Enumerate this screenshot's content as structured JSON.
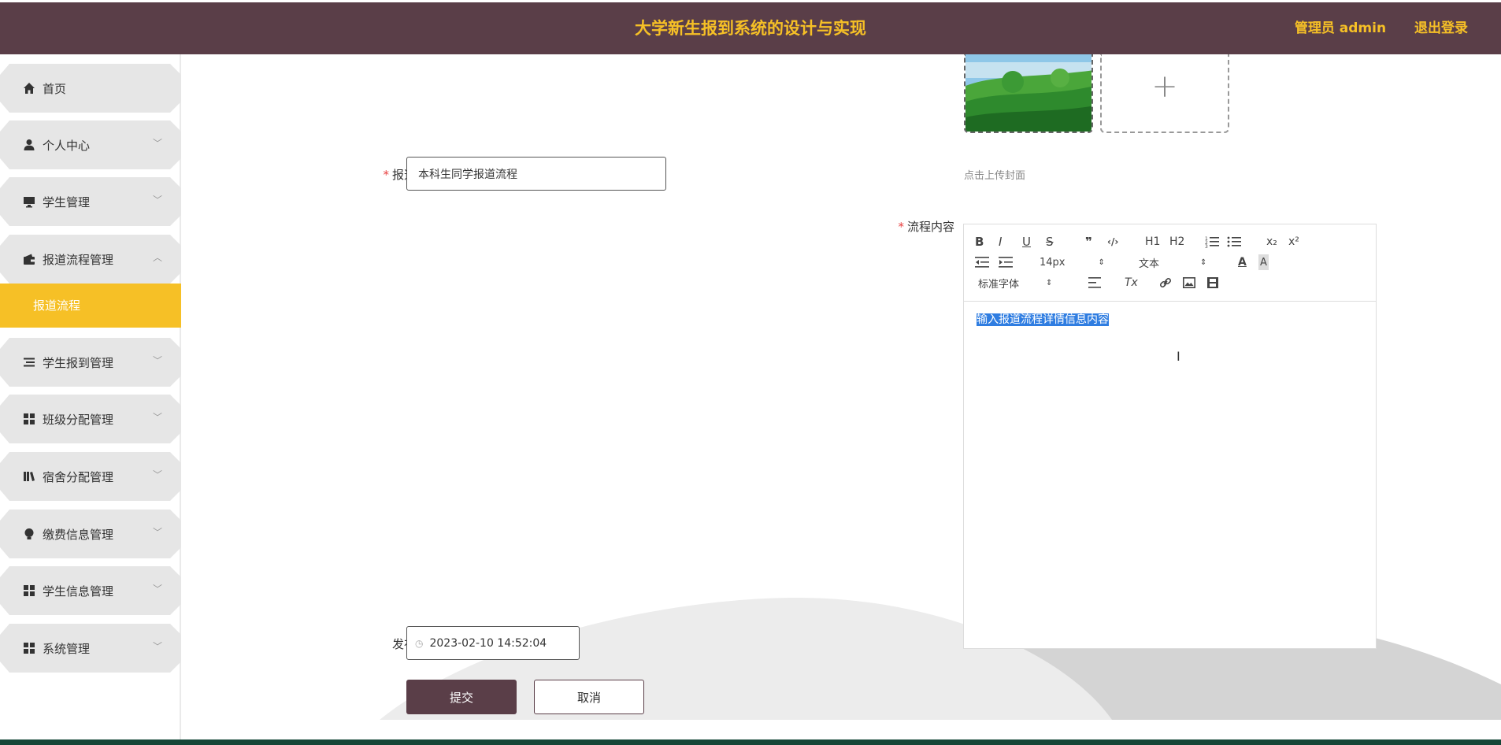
{
  "header": {
    "title": "大学新生报到系统的设计与实现",
    "user_label": "管理员 admin",
    "logout_label": "退出登录"
  },
  "sidebar": {
    "items": [
      {
        "label": "首页",
        "icon": "home-icon",
        "expandable": false
      },
      {
        "label": "个人中心",
        "icon": "user-icon",
        "expandable": true
      },
      {
        "label": "学生管理",
        "icon": "monitor-icon",
        "expandable": true
      },
      {
        "label": "报道流程管理",
        "icon": "wallet-icon",
        "expandable": true,
        "expanded": true
      },
      {
        "label": "学生报到管理",
        "icon": "list-icon",
        "expandable": true
      },
      {
        "label": "班级分配管理",
        "icon": "grid-icon",
        "expandable": true
      },
      {
        "label": "宿舍分配管理",
        "icon": "book-icon",
        "expandable": true
      },
      {
        "label": "缴费信息管理",
        "icon": "bulb-icon",
        "expandable": true
      },
      {
        "label": "学生信息管理",
        "icon": "grid-icon",
        "expandable": true
      },
      {
        "label": "系统管理",
        "icon": "grid-icon",
        "expandable": true
      }
    ],
    "submenu_active": "报道流程"
  },
  "form": {
    "title_label": "报道标题",
    "title_value": "本科生同学报道流程",
    "cover_hint": "点击上传封面",
    "content_label": "流程内容",
    "date_label": "发布日期",
    "date_value": "2023-02-10 14:52:04",
    "submit_label": "提交",
    "cancel_label": "取消"
  },
  "editor": {
    "font_size": "14px",
    "text_style": "文本",
    "font_family": "标准字体",
    "content": "输入报道流程详情信息内容",
    "toolbar_glyphs": {
      "bold": "B",
      "italic": "I",
      "underline": "U",
      "strike": "S",
      "quote": "❞",
      "code": "‹/›",
      "h1": "H1",
      "h2": "H2",
      "sub": "x₂",
      "sup": "x²",
      "clean": "Tx"
    }
  },
  "colors": {
    "header_bg": "#5a3e48",
    "accent": "#f6c026",
    "menu_bg": "#e6e6e6",
    "selection": "#2f7de1"
  }
}
